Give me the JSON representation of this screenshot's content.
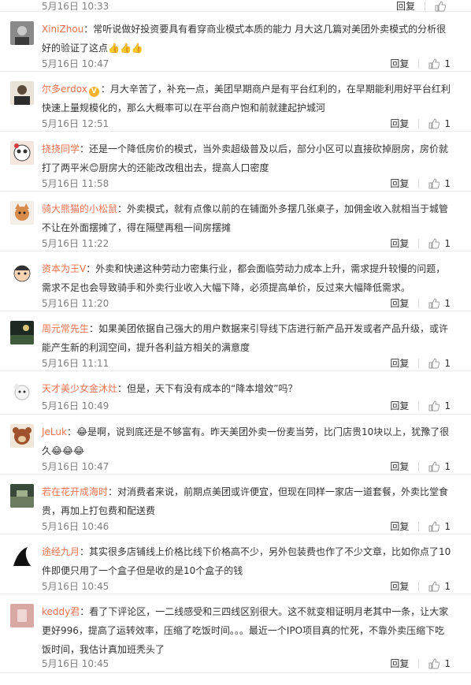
{
  "reply_label": "回复",
  "comments": [
    {
      "user": "",
      "emoji": [],
      "text": "",
      "time": "5月16日 10:33",
      "likes": ""
    },
    {
      "user": "XiniZhou",
      "emoji": [
        "laugh"
      ],
      "text": "：常听说做好投资要具有看穿商业模式本质的能力 月大这几篇对美团外卖模式的分析很好的验证了这点👍👍👍",
      "time": "5月16日 10:47",
      "likes": "1"
    },
    {
      "user": "尔多erdox",
      "emoji": [],
      "text": "：月大辛苦了，补充一点，美团早期商户是有平台红利的，在早期能利用好平台红利快速上量规模化的，那么大概率可以在平台商户饱和前就建起护城河",
      "time": "5月16日 12:51",
      "likes": "1"
    },
    {
      "user": "挠挠同学",
      "emoji": [],
      "text": "：还是一个降低房价的模式，当外卖超级普及以后，部分小区可以直接砍掉厨房，房价就打了两平米😊厨房大的还能改改租出去，提高人口密度",
      "time": "5月16日 11:58",
      "likes": "1"
    },
    {
      "user": "骑大熊猫的小松鼠",
      "emoji": [],
      "text": "：外卖模式，就有点像以前的在铺面外多摆几张桌子，加佣金收入就相当于城管不让在外面摆摊了，得在隔壁再租一间房摆摊",
      "time": "5月16日 11:22",
      "likes": "1"
    },
    {
      "user": "资本为王V",
      "emoji": [],
      "text": "：外卖和快递这种劳动力密集行业，都会面临劳动力成本上升，需求提升较慢的问题，需求不足也会导致骑手和外卖行业收入大幅下降，必须提高单价，反过来大幅降低需求。",
      "time": "5月16日 11:20",
      "likes": "1"
    },
    {
      "user": "周元常先生",
      "emoji": [],
      "text": "：如果美团依据自己强大的用户数据来引导线下店进行新产品开发或者产品升级，或许能产生新的利润空间，提升各利益方相关的满意度",
      "time": "5月16日 11:11",
      "likes": "1"
    },
    {
      "user": "天才美少女金沐灶",
      "emoji": [],
      "text": "：但是，天下有没有成本的“降本增效”吗？",
      "time": "5月16日 10:49",
      "likes": "1"
    },
    {
      "user": "JeLuk",
      "emoji": [],
      "text": "：😂是啊，说到底还是不够富有。昨天美团外卖一份麦当劳，比门店贵10块以上，犹豫了很久😂😂😂",
      "time": "5月16日 10:47",
      "likes": "1"
    },
    {
      "user": "若在花开成海时",
      "emoji": [],
      "text": "：对消费者来说，前期点美团或许便宜，但现在同样一家店一道套餐，外卖比堂食贵，再加上打包费和配送费",
      "time": "5月16日 10:46",
      "likes": "1"
    },
    {
      "user": "途经九月",
      "emoji": [],
      "text": "：其实很多店铺线上价格比线下价格高不少，另外包装费也作了不少文章，比如你点了10件即便只用了一个盒子但是收的是10个盒子的钱",
      "time": "5月16日 10:45",
      "likes": "1"
    },
    {
      "user": "keddy君",
      "emoji": [],
      "text": "：看了下评论区，一二线感受和三四线区别很大。这不就变相证明月老其中一条，让大家更好996，提高了运转效率，压缩了吃饭时间。。。最近一个IPO项目真的忙死，不靠外卖压缩下吃饭时间，我估计真加班秃头了",
      "time": "5月16日 10:45",
      "likes": "1"
    }
  ],
  "colors": {
    "username": "#eb7350",
    "meta": "#808080",
    "divider": "#ececec"
  }
}
